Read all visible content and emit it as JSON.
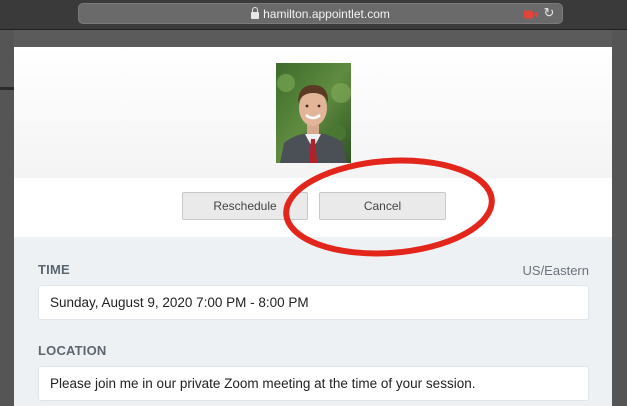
{
  "browser": {
    "url": "hamilton.appointlet.com",
    "lock_icon": "lock-icon",
    "camera_icon": "camera-recording-icon",
    "reload_icon": "reload-icon",
    "reload_glyph": "↻"
  },
  "profile": {
    "avatar_icon": "person-photo"
  },
  "actions": {
    "reschedule_label": "Reschedule",
    "cancel_label": "Cancel"
  },
  "details": {
    "time_label": "TIME",
    "timezone": "US/Eastern",
    "time_value": "Sunday, August 9, 2020 7:00 PM - 8:00 PM",
    "location_label": "LOCATION",
    "location_value": "Please join me in our private Zoom meeting at the time of your session."
  },
  "colors": {
    "annotation_circle": "#e3261b",
    "record_indicator": "#e0443a",
    "details_background": "#eef1f4"
  }
}
